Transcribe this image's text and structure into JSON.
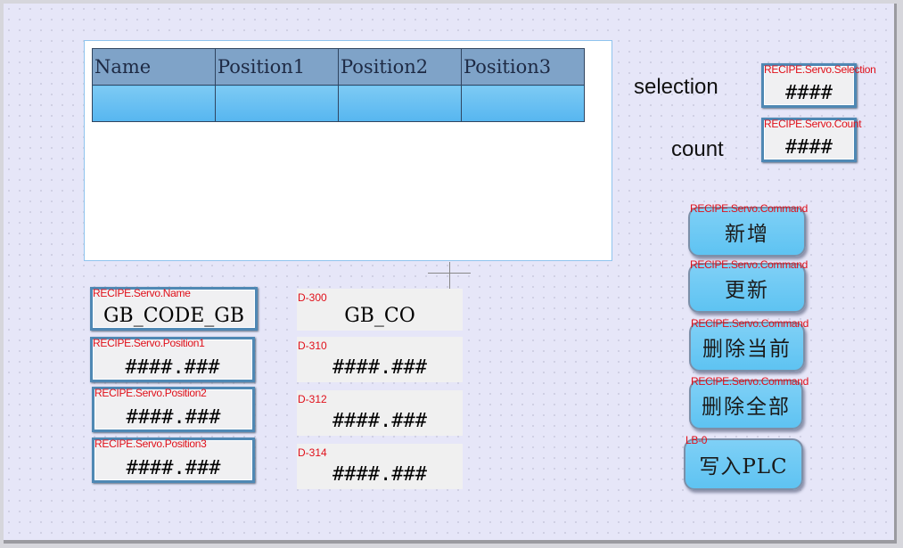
{
  "table": {
    "headers": [
      "Name",
      "Position1",
      "Position2",
      "Position3"
    ],
    "rows": [
      [
        "",
        "",
        "",
        ""
      ]
    ]
  },
  "labels": {
    "selection": "selection",
    "count": "count"
  },
  "fields": {
    "selection": {
      "tag": "RECIPE.Servo.Selection",
      "value": "####"
    },
    "count": {
      "tag": "RECIPE.Servo.Count",
      "value": "####"
    },
    "name": {
      "tag": "RECIPE.Servo.Name",
      "value": "GB_CODE_GB"
    },
    "position1": {
      "tag": "RECIPE.Servo.Position1",
      "value": "####.###"
    },
    "position2": {
      "tag": "RECIPE.Servo.Position2",
      "value": "####.###"
    },
    "position3": {
      "tag": "RECIPE.Servo.Position3",
      "value": "####.###"
    }
  },
  "registers": [
    {
      "tag": "D-300",
      "value": "GB_CO"
    },
    {
      "tag": "D-310",
      "value": "####.###"
    },
    {
      "tag": "D-312",
      "value": "####.###"
    },
    {
      "tag": "D-314",
      "value": "####.###"
    }
  ],
  "buttons": [
    {
      "tag": "RECIPE.Servo.Command",
      "label": "新增"
    },
    {
      "tag": "RECIPE.Servo.Command",
      "label": "更新"
    },
    {
      "tag": "RECIPE.Servo.Command",
      "label": "删除当前"
    },
    {
      "tag": "RECIPE.Servo.Command",
      "label": "删除全部"
    },
    {
      "tag": "LB-0",
      "label": "写入PLC"
    }
  ],
  "colors": {
    "accent": "#5ec3f2",
    "tag_red": "#e0101a",
    "header": "#7fa3c8",
    "canvas": "#e6e6f8"
  }
}
